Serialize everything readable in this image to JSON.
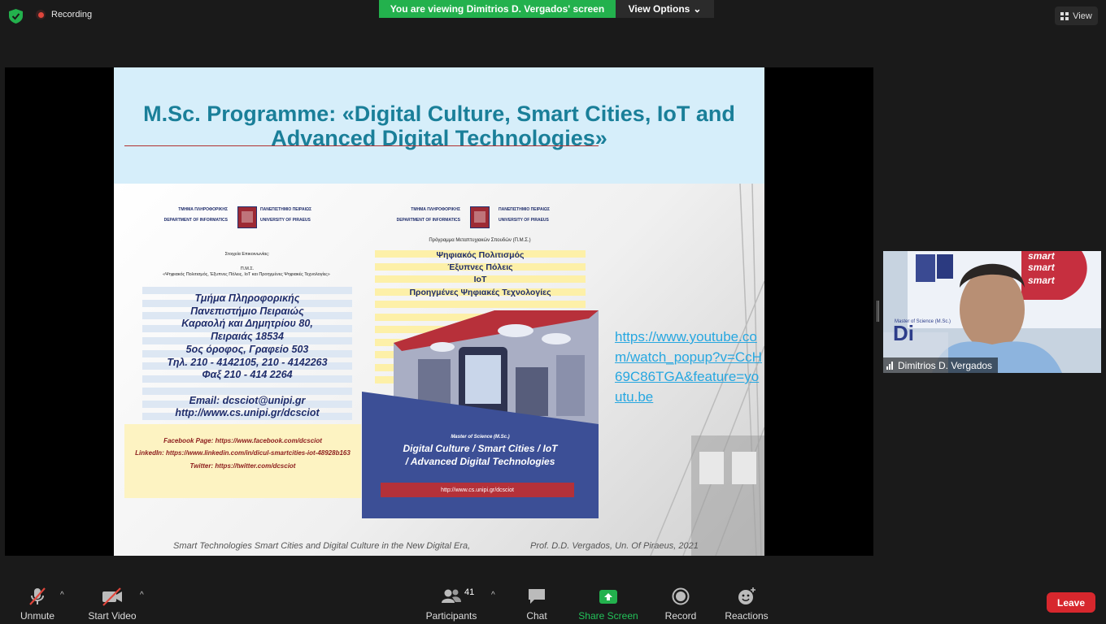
{
  "top_bar": {
    "recording_label": "Recording",
    "viewing_banner": "You are viewing Dimitrios D. Vergados' screen",
    "view_options_label": "View Options",
    "view_label": "View"
  },
  "slide": {
    "title": "M.Sc. Programme: «Digital Culture, Smart Cities, IoT and Advanced Digital Technologies»",
    "letterhead_left": {
      "dept_gr": "ΤΜΗΜΑ ΠΛΗΡΟΦΟΡΙΚΗΣ",
      "dept_en": "DEPARTMENT OF INFORMATICS",
      "univ_gr": "ΠΑΝΕΠΙΣΤΗΜΙΟ ΠΕΙΡΑΙΩΣ",
      "univ_en": "UNIVERSITY OF PIRAEUS"
    },
    "letterhead_right": {
      "dept_gr": "ΤΜΗΜΑ ΠΛΗΡΟΦΟΡΙΚΗΣ",
      "dept_en": "DEPARTMENT OF INFORMATICS",
      "univ_gr": "ΠΑΝΕΠΙΣΤΗΜΙΟ ΠΕΙΡΑΙΩΣ",
      "univ_en": "UNIVERSITY OF PIRAEUS"
    },
    "contact_heading": "Στοιχεία Επικοινωνίας:",
    "pms_label": "Π.Μ.Σ.",
    "pms_name": "«Ψηφιακός Πολιτισμός, Έξυπνες Πόλεις, IoT και Προηγμένες Ψηφιακές Τεχνολογίες»",
    "contact_lines": [
      "Τμήμα Πληροφορικής",
      "Πανεπιστήμιο Πειραιώς",
      "Καραολή και Δημητρίου 80,",
      "Πειραιάς 18534",
      "5ος όροφος, Γραφείο 503",
      "Τηλ. 210 - 4142105, 210 - 4142263",
      "Φαξ 210 - 414 2264",
      "",
      "Email: dcsciot@unipi.gr",
      "http://www.cs.unipi.gr/dcsciot"
    ],
    "social": {
      "facebook": "Facebook Page: https://www.facebook.com/dcsciot",
      "linkedin": "LinkedIn: https://www.linkedin.com/in/dicul-smartcities-iot-48928b163",
      "twitter": "Twitter: https://twitter.com/dcsciot"
    },
    "programme_heading": "Πρόγραμμα Μεταπτυχιακών Σπουδών (Π.Μ.Σ.)",
    "programme_lines": [
      "Ψηφιακός Πολιτισμός",
      "Έξυπνες Πόλεις",
      "IoT",
      "Προηγμένες Ψηφιακές Τεχνολογίες"
    ],
    "panel_msc": "Master of Science (M.Sc.)",
    "panel_title_line1": "Digital Culture / Smart Cities / IoT",
    "panel_title_line2": "/ Advanced Digital Technologies",
    "panel_link": "http://www.cs.unipi.gr/dcsciot",
    "youtube_link": "https://www.youtube.com/watch_popup?v=CcH69C86TGA&feature=youtu.be",
    "footer_left": "Smart Technologies Smart Cities and Digital Culture in the New Digital Era,",
    "footer_right": "Prof. D.D. Vergados, Un. Of Piraeus, 2021"
  },
  "video": {
    "participant_name": "Dimitrios D. Vergados",
    "overlay_text_lines": [
      "smart",
      "smart",
      "smart"
    ],
    "overlay_small": "Master of Science (M.Sc.)"
  },
  "toolbar": {
    "unmute": "Unmute",
    "start_video": "Start Video",
    "participants": "Participants",
    "participants_count": "41",
    "chat": "Chat",
    "share_screen": "Share Screen",
    "record": "Record",
    "reactions": "Reactions",
    "leave": "Leave"
  },
  "colors": {
    "share_green": "#23b14d",
    "leave_red": "#d7272d",
    "slide_title": "#1a7f99",
    "link_blue": "#27a7e0"
  }
}
